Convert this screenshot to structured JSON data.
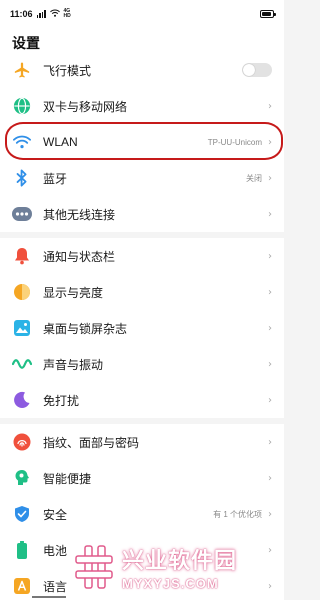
{
  "status_bar": {
    "time": "11:06",
    "network_top": "4G",
    "network_bottom": "HD"
  },
  "page": {
    "title": "设置"
  },
  "groups": [
    {
      "items": [
        {
          "label": "飞行模式",
          "icon": "airplane-icon",
          "control": "toggle",
          "toggle_on": false,
          "icon_color": "#f5a623"
        },
        {
          "label": "双卡与移动网络",
          "icon": "globe-icon",
          "icon_color": "#1fbf86"
        },
        {
          "label": "WLAN",
          "icon": "wifi-icon",
          "value": "TP-UU-Unicom",
          "icon_color": "#2f8fe8"
        },
        {
          "label": "蓝牙",
          "icon": "bluetooth-icon",
          "value": "关闭",
          "icon_color": "#2f8fe8"
        },
        {
          "label": "其他无线连接",
          "icon": "more-dots-icon",
          "icon_color": "#6e7f99"
        }
      ]
    },
    {
      "items": [
        {
          "label": "通知与状态栏",
          "icon": "bell-icon",
          "icon_color": "#f0503c"
        },
        {
          "label": "显示与亮度",
          "icon": "brightness-icon",
          "icon_color": "#f5a623"
        },
        {
          "label": "桌面与锁屏杂志",
          "icon": "wallpaper-icon",
          "icon_color": "#2bb3e6"
        },
        {
          "label": "声音与振动",
          "icon": "sound-icon",
          "icon_color": "#1fbf86"
        },
        {
          "label": "免打扰",
          "icon": "moon-icon",
          "icon_color": "#8d5be0"
        }
      ]
    },
    {
      "items": [
        {
          "label": "指纹、面部与密码",
          "icon": "fingerprint-icon",
          "icon_color": "#f0503c"
        },
        {
          "label": "智能便捷",
          "icon": "smart-assist-icon",
          "icon_color": "#1fbf86"
        },
        {
          "label": "安全",
          "icon": "shield-icon",
          "value": "有 1 个优化项",
          "icon_color": "#2f8fe8"
        },
        {
          "label": "电池",
          "icon": "battery-icon",
          "icon_color": "#1fbf86"
        },
        {
          "label": "语言",
          "icon": "language-icon",
          "icon_color": "#f5a623"
        }
      ]
    }
  ],
  "watermark": {
    "text": "兴业软件园",
    "url": "MYXYJS.COM",
    "color": "#e05a8b"
  },
  "annotation": {
    "color": "#c61a1a"
  }
}
